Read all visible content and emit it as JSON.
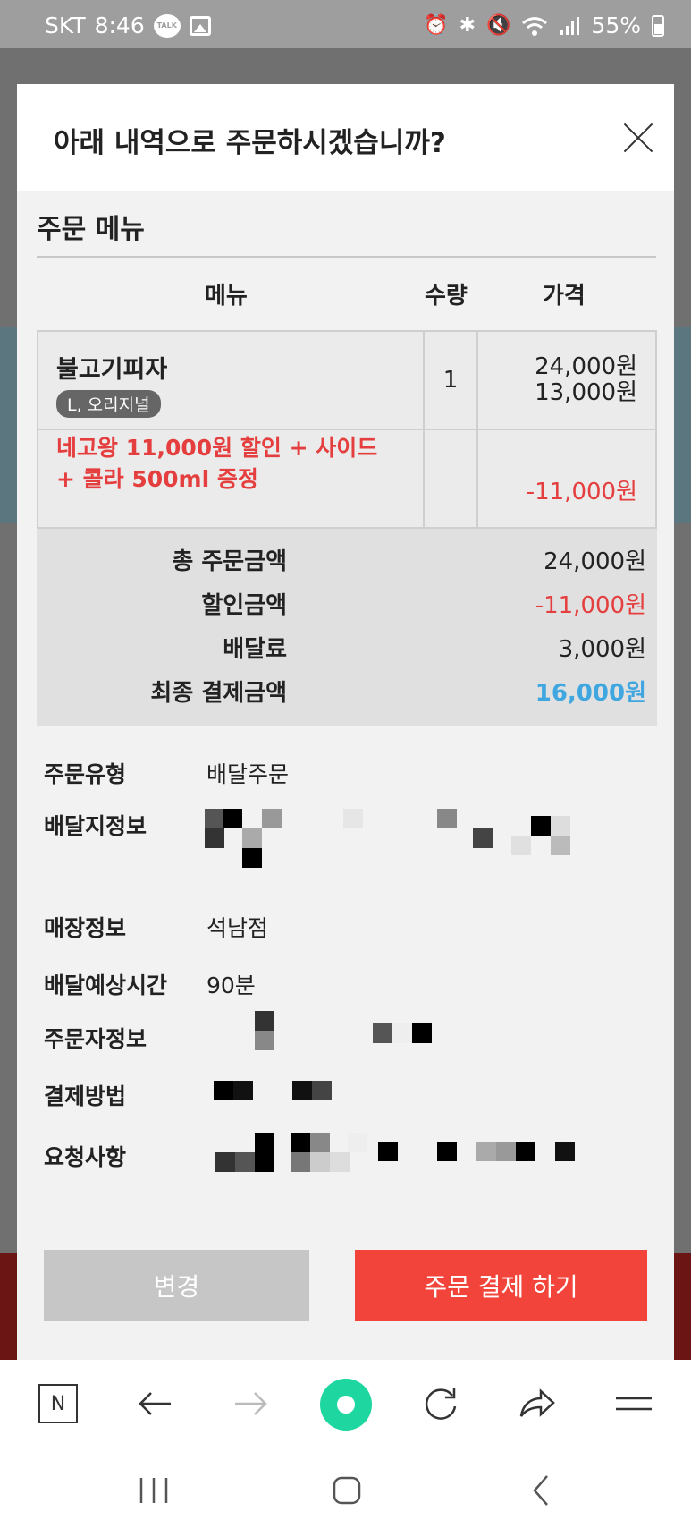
{
  "status_bar": {
    "carrier": "SKT",
    "time": "8:46",
    "talk_label": "TALK",
    "battery": "55%"
  },
  "modal": {
    "title": "아래 내역으로 주문하시겠습니까?",
    "section_title": "주문 메뉴",
    "columns": {
      "menu": "메뉴",
      "qty": "수량",
      "price": "가격"
    },
    "items": [
      {
        "name": "불고기피자",
        "option": "L, 오리지널",
        "qty": "1",
        "price_original": "24,000원",
        "price_sale": "13,000원"
      }
    ],
    "promotion": {
      "text_line1": "네고왕 11,000원 할인 + 사이드",
      "text_line2": "+ 콜라 500ml 증정",
      "price": "-11,000원"
    },
    "totals": [
      {
        "label": "총 주문금액",
        "value": "24,000원",
        "style": "normal"
      },
      {
        "label": "할인금액",
        "value": "-11,000원",
        "style": "red"
      },
      {
        "label": "배달료",
        "value": "3,000원",
        "style": "normal"
      },
      {
        "label": "최종 결제금액",
        "value": "16,000원",
        "style": "blue"
      }
    ],
    "info": {
      "order_type_label": "주문유형",
      "order_type_value": "배달주문",
      "address_label": "배달지정보",
      "store_label": "매장정보",
      "store_value": "석남점",
      "eta_label": "배달예상시간",
      "eta_value": "90분",
      "orderer_label": "주문자정보",
      "payment_label": "결제방법",
      "request_label": "요청사항"
    },
    "buttons": {
      "change": "변경",
      "pay": "주문 결제 하기"
    }
  },
  "browser_bar": {
    "home_letter": "N"
  },
  "colors": {
    "accent_red": "#f3443b",
    "price_red": "#e53e3e",
    "final_blue": "#3fa6e0",
    "toolbar_green": "#1ed7a0"
  }
}
